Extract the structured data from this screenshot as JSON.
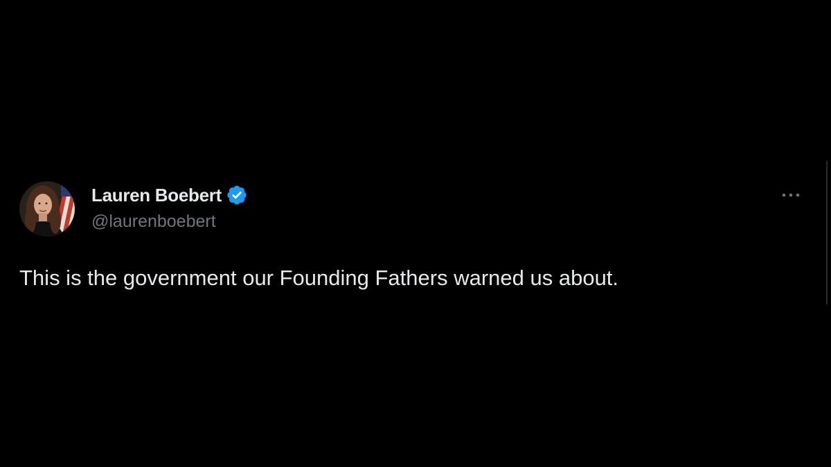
{
  "tweet": {
    "author": {
      "display_name": "Lauren Boebert",
      "handle": "@laurenboebert",
      "verified": true,
      "verified_badge_color": "#1d9bf0",
      "avatar_icon": "profile-photo-avatar"
    },
    "text": "This is the government our Founding Fathers warned us about.",
    "more_icon": "more-horizontal-icon"
  },
  "colors": {
    "background": "#000000",
    "primary_text": "#e7e9ea",
    "secondary_text": "#71767b",
    "accent": "#1d9bf0"
  }
}
